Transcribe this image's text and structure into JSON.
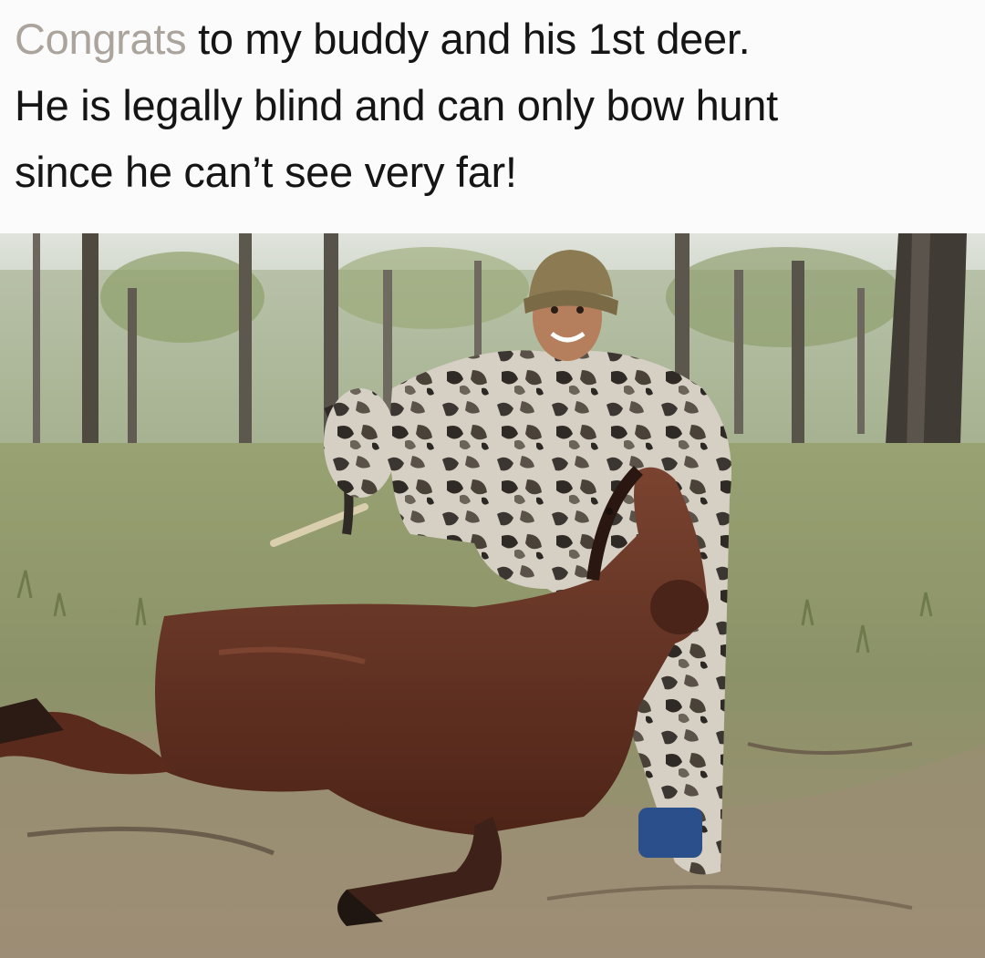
{
  "caption": {
    "lead_word": "Congrats",
    "line1_rest": " to my buddy and his 1st deer.",
    "line2": "He is legally blind and can only bow hunt",
    "line3": "since he can’t see very far!"
  },
  "photo": {
    "subjects": [
      "hunter-in-camouflage",
      "horse-lying-down",
      "compound-bow",
      "eucalyptus-woodland"
    ],
    "colors": {
      "sky": "#d7ddd5",
      "grass": "#8f9a6c",
      "ground": "#9c8c76",
      "horse": "#6a3524",
      "camo_light": "#d8d2c8",
      "camo_dark": "#3a3530"
    }
  }
}
